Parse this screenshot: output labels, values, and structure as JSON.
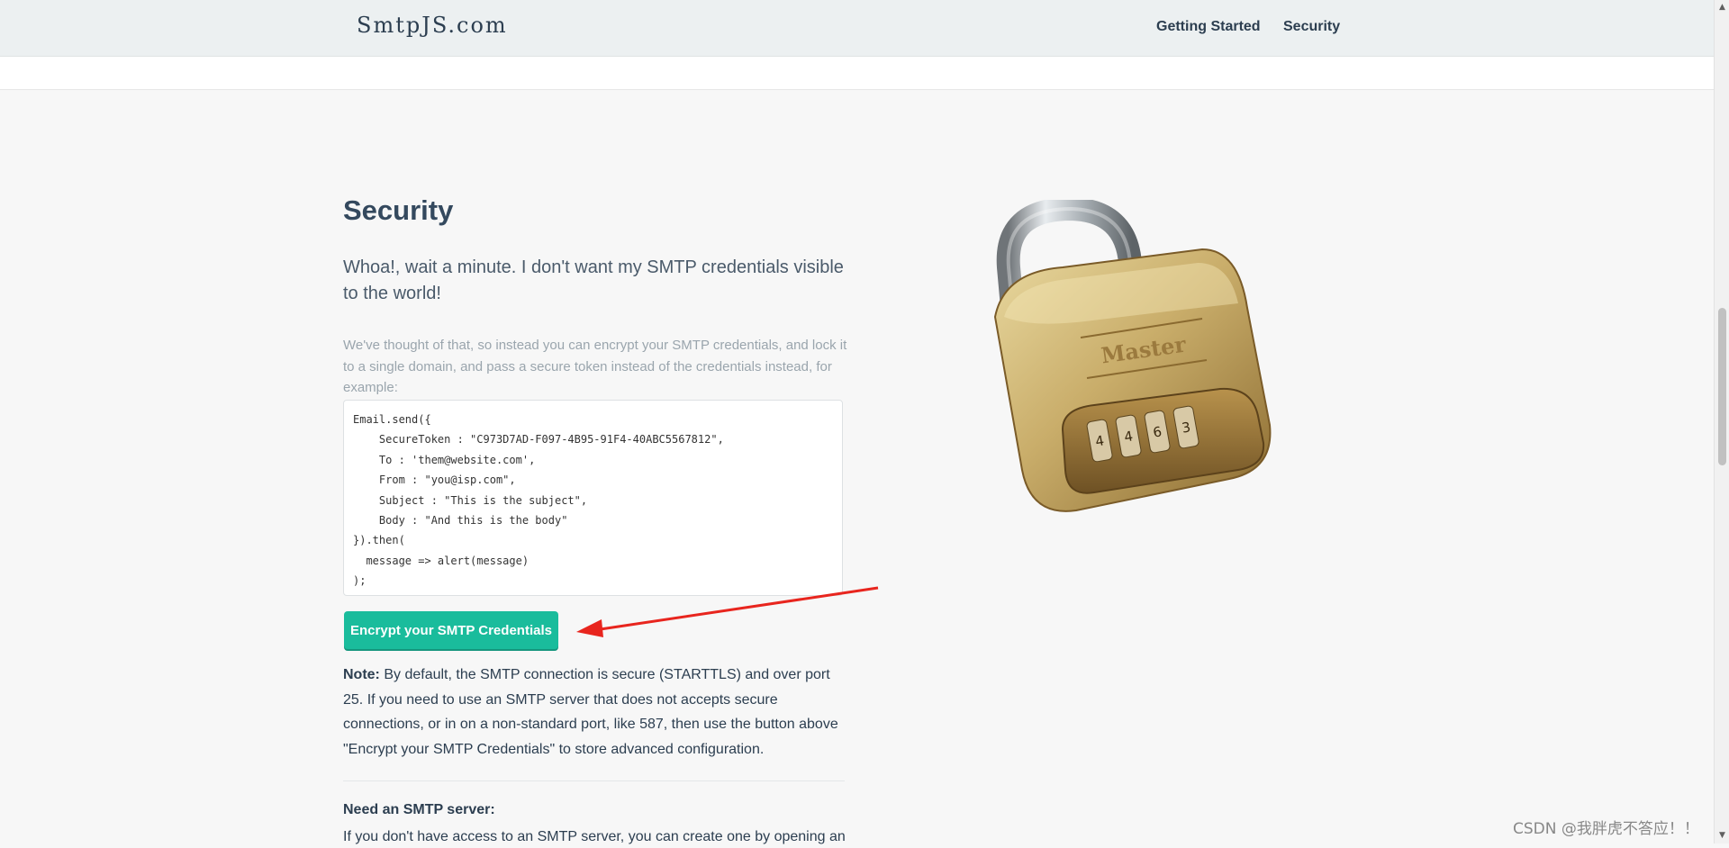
{
  "navbar": {
    "brand": "SmtpJS.com",
    "links": [
      {
        "label": "Getting Started"
      },
      {
        "label": "Security"
      }
    ]
  },
  "security_section": {
    "title": "Security",
    "lead": "Whoa!, wait a minute. I don't want my SMTP credentials visible to the world!",
    "description": "We've thought of that, so instead you can encrypt your SMTP credentials, and lock it to a single domain, and pass a secure token instead of the credentials instead, for example:",
    "code_example": "Email.send({\n    SecureToken : \"C973D7AD-F097-4B95-91F4-40ABC5567812\",\n    To : 'them@website.com',\n    From : \"you@isp.com\",\n    Subject : \"This is the subject\",\n    Body : \"And this is the body\"\n}).then(\n  message => alert(message)\n);",
    "encrypt_button_label": "Encrypt your SMTP Credentials",
    "note_label": "Note:",
    "note_text": " By default, the SMTP connection is secure (STARTTLS) and over port 25. If you need to use an SMTP server that does not accepts secure connections, or in on a non-standard port, like 587, then use the button above \"Encrypt your SMTP Credentials\" to store advanced configuration.",
    "need_server_heading": "Need an SMTP server:",
    "need_server_text": "If you don't have access to an SMTP server, you can create one by opening an"
  },
  "padlock_image": {
    "icon": "padlock-icon",
    "brand_text": "Master",
    "dial_digits": [
      "4",
      "4",
      "6",
      "3"
    ]
  },
  "annotation": {
    "arrow_color": "#e8251e"
  },
  "watermark": "CSDN @我胖虎不答应！！",
  "colors": {
    "accent": "#1abc9c",
    "navbar_bg": "#ecf0f1",
    "text": "#2c3e50"
  }
}
